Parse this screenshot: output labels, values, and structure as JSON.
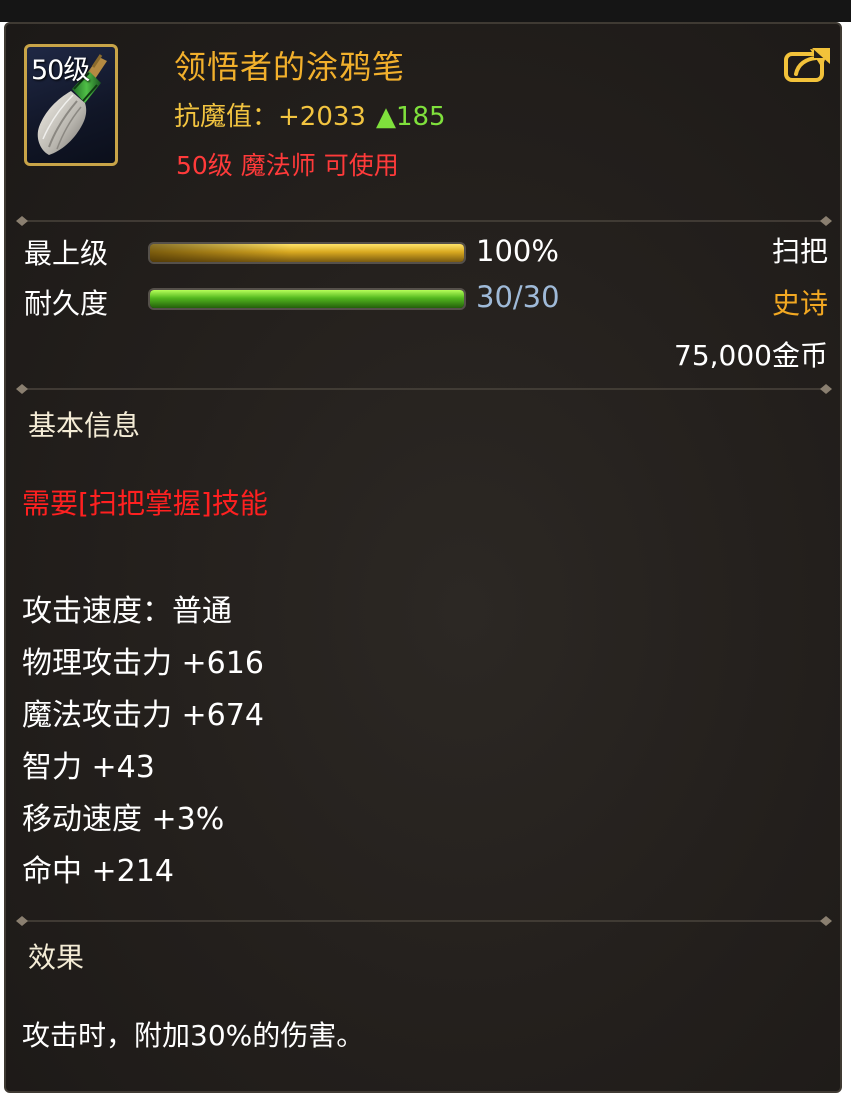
{
  "item": {
    "level_badge": "50级",
    "name": "领悟者的涂鸦笔",
    "resist_label": "抗魔值：",
    "resist_value": "+2033",
    "resist_increase": "▲185",
    "requirement": "50级 魔法师 可使用",
    "icon": "broom-brush-icon",
    "share_icon": "share-export-icon"
  },
  "bars": {
    "upgrade": {
      "label": "最上级",
      "value_text": "100%",
      "fraction": 1.0
    },
    "durability": {
      "label": "耐久度",
      "value_text": "30/30",
      "fraction": 1.0
    }
  },
  "info_right": {
    "type": "扫把",
    "rarity": "史诗",
    "price": "75,000金币"
  },
  "basic_info": {
    "title": "基本信息",
    "skill_requirement": "需要[扫把掌握]技能",
    "attributes": [
      "攻击速度：普通",
      "物理攻击力 +616",
      "魔法攻击力 +674",
      "智力 +43",
      "移动速度 +3%",
      "命中 +214"
    ]
  },
  "effect": {
    "title": "效果",
    "text": "攻击时，附加30%的伤害。"
  },
  "colors": {
    "item_name": "#f2b02c",
    "requirement": "#ff3a3a",
    "rarity_epic": "#f2a822",
    "increase_green": "#7fe03c",
    "icon_border": "#c8a448"
  }
}
